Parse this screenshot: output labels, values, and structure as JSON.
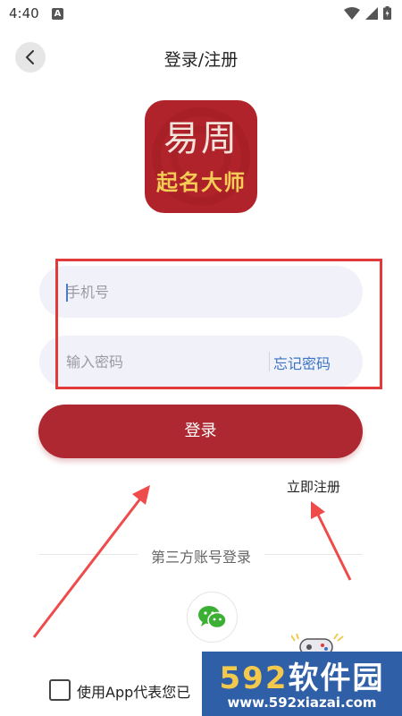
{
  "status_bar": {
    "time": "4:40",
    "notification_letter": "A"
  },
  "header": {
    "title": "登录/注册"
  },
  "logo": {
    "top_text": "易周",
    "bottom_text": "起名大师"
  },
  "form": {
    "phone_placeholder": "手机号",
    "password_placeholder": "输入密码",
    "forgot_label": "忘记密码",
    "login_label": "登录",
    "register_label": "立即注册"
  },
  "third_party": {
    "title": "第三方账号登录",
    "providers": [
      "wechat"
    ]
  },
  "agreement": {
    "text": "使用App代表您已"
  },
  "watermark": {
    "brand_num": "592",
    "brand_text": "软件园",
    "url": "www.592xiazai.com"
  },
  "colors": {
    "primary": "#ad2830",
    "link": "#3c74c4",
    "highlight": "#e03a3a",
    "watermark_bg": "#2f5fa7"
  }
}
